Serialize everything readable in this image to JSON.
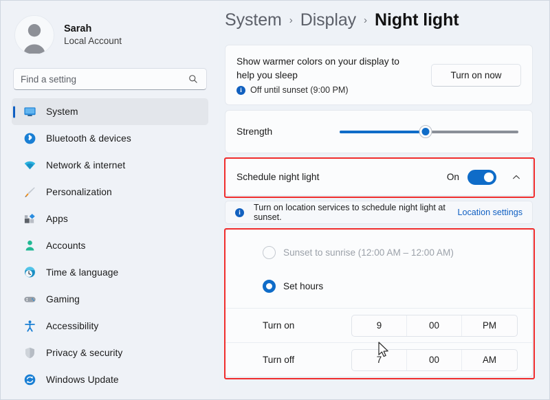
{
  "account": {
    "name": "Sarah",
    "type": "Local Account",
    "avatar_icon": "person-avatar-icon"
  },
  "search": {
    "placeholder": "Find a setting",
    "icon": "search-icon"
  },
  "sidebar": {
    "items": [
      {
        "label": "System",
        "icon": "monitor-icon",
        "selected": true
      },
      {
        "label": "Bluetooth & devices",
        "icon": "bluetooth-icon",
        "selected": false
      },
      {
        "label": "Network & internet",
        "icon": "wifi-icon",
        "selected": false
      },
      {
        "label": "Personalization",
        "icon": "paintbrush-icon",
        "selected": false
      },
      {
        "label": "Apps",
        "icon": "apps-icon",
        "selected": false
      },
      {
        "label": "Accounts",
        "icon": "account-person-icon",
        "selected": false
      },
      {
        "label": "Time & language",
        "icon": "clock-globe-icon",
        "selected": false
      },
      {
        "label": "Gaming",
        "icon": "gamepad-icon",
        "selected": false
      },
      {
        "label": "Accessibility",
        "icon": "accessibility-icon",
        "selected": false
      },
      {
        "label": "Privacy & security",
        "icon": "shield-icon",
        "selected": false
      },
      {
        "label": "Windows Update",
        "icon": "update-refresh-icon",
        "selected": false
      }
    ]
  },
  "breadcrumb": {
    "root": "System",
    "parent": "Display",
    "current": "Night light",
    "separator": "›"
  },
  "intro_card": {
    "title": "Show warmer colors on your display to help you sleep",
    "status_icon": "info-icon",
    "status_text": "Off until sunset (9:00 PM)",
    "button_label": "Turn on now"
  },
  "strength_card": {
    "label": "Strength",
    "value_percent": 48
  },
  "schedule_card": {
    "label": "Schedule night light",
    "toggle_state": "On",
    "toggle_on": true,
    "expand_icon": "chevron-up-icon"
  },
  "info_bar": {
    "icon": "info-icon",
    "text": "Turn on location services to schedule night light at sunset.",
    "link_label": "Location settings"
  },
  "schedule_panel": {
    "options": [
      {
        "label": "Sunset to sunrise (12:00 AM – 12:00 AM)",
        "selected": false,
        "disabled": true
      },
      {
        "label": "Set hours",
        "selected": true,
        "disabled": false
      }
    ],
    "turn_on": {
      "label": "Turn on",
      "hour": "9",
      "minute": "00",
      "meridiem": "PM"
    },
    "turn_off": {
      "label": "Turn off",
      "hour": "7",
      "minute": "00",
      "meridiem": "AM"
    }
  },
  "colors": {
    "accent": "#0f6cc8",
    "accent_bar": "#0f5fc2",
    "link": "#0f5fc2",
    "highlight": "#f02c2c",
    "page_bg": "#eef2f7",
    "card_bg": "#fbfcfd"
  }
}
